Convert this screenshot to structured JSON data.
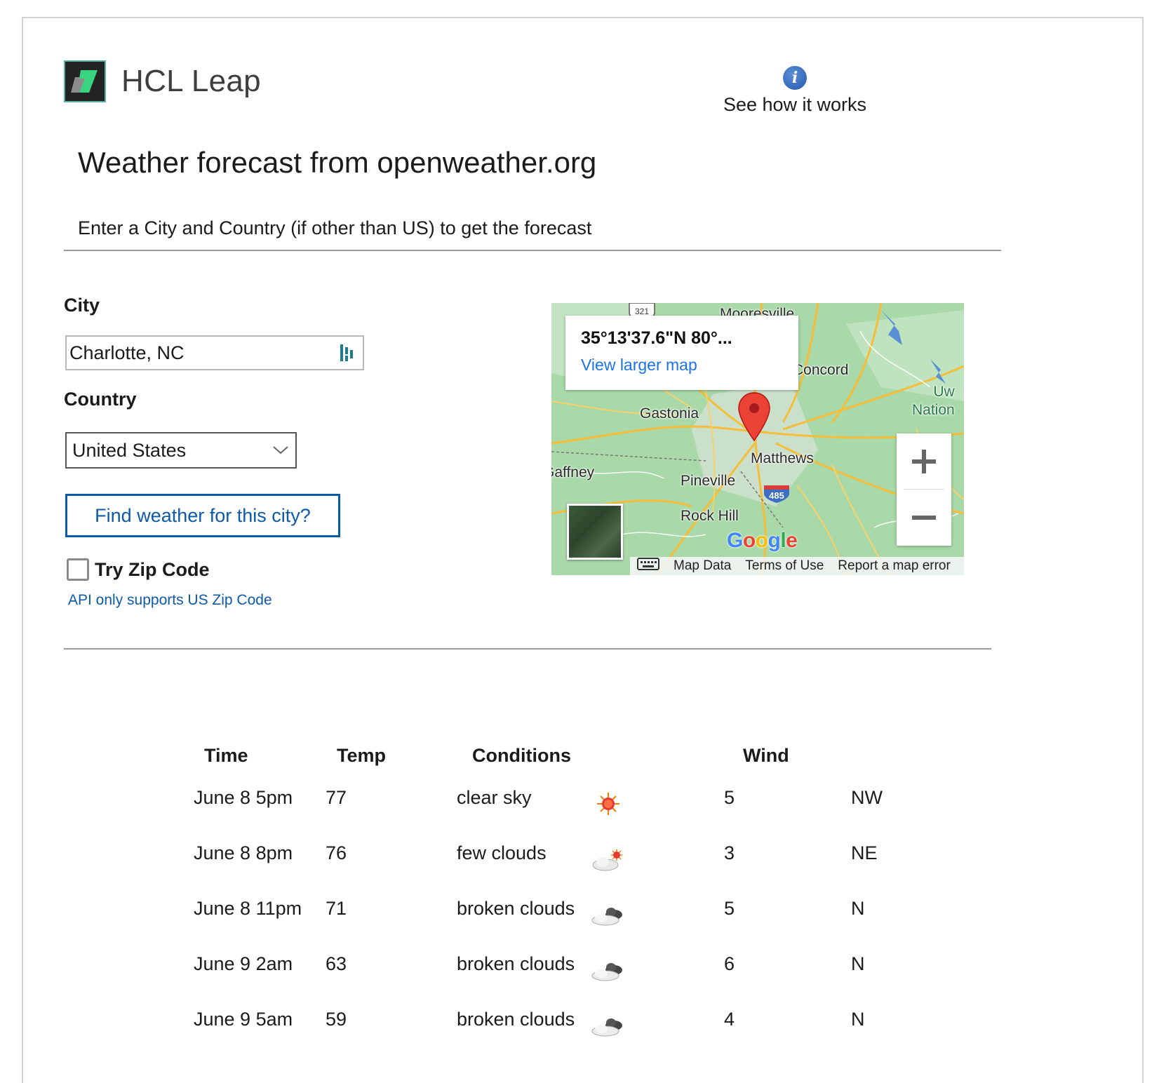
{
  "header": {
    "brand": "HCL Leap",
    "help_label": "See how it works"
  },
  "page": {
    "title": "Weather forecast from openweather.org",
    "subtitle": "Enter a City and Country (if other than US) to get the forecast"
  },
  "form": {
    "city_label": "City",
    "city_value": "Charlotte, NC",
    "country_label": "Country",
    "country_value": "United States",
    "find_button": "Find weather for this city?",
    "zip_checkbox_label": "Try Zip Code",
    "zip_checked": false,
    "zip_note": "API only supports US Zip Code"
  },
  "map": {
    "coords": "35°13'37.6\"N 80°...",
    "view_larger": "View larger map",
    "places": [
      "Mooresville",
      "Concord",
      "Gastonia",
      "Matthews",
      "Pineville",
      "Rock Hill",
      "Gaffney",
      "Uwharrie National"
    ],
    "shields": [
      "321",
      "485"
    ],
    "google": "Google",
    "footer": [
      "Map Data",
      "Terms of Use",
      "Report a map error"
    ],
    "icons": [
      "map-pin-icon",
      "zoom-in-icon",
      "zoom-out-icon",
      "keyboard-icon"
    ]
  },
  "forecast": {
    "headers": [
      "Time",
      "Temp",
      "Conditions",
      "Wind"
    ],
    "rows": [
      {
        "time": "June 8 5pm",
        "temp": "77",
        "conditions": "clear sky",
        "icon": "sun-icon",
        "wind": "5",
        "dir": "NW"
      },
      {
        "time": "June 8 8pm",
        "temp": "76",
        "conditions": "few clouds",
        "icon": "few-clouds-icon",
        "wind": "3",
        "dir": "NE"
      },
      {
        "time": "June 8 11pm",
        "temp": "71",
        "conditions": "broken clouds",
        "icon": "broken-clouds-icon",
        "wind": "5",
        "dir": "N"
      },
      {
        "time": "June 9 2am",
        "temp": "63",
        "conditions": "broken clouds",
        "icon": "broken-clouds-icon",
        "wind": "6",
        "dir": "N"
      },
      {
        "time": "June 9 5am",
        "temp": "59",
        "conditions": "broken clouds",
        "icon": "broken-clouds-icon",
        "wind": "4",
        "dir": "N"
      }
    ]
  },
  "colors": {
    "link": "#0d5aa7",
    "map_link": "#1a73e8",
    "map_land": "#a8d8a8",
    "pin": "#ea4335"
  }
}
